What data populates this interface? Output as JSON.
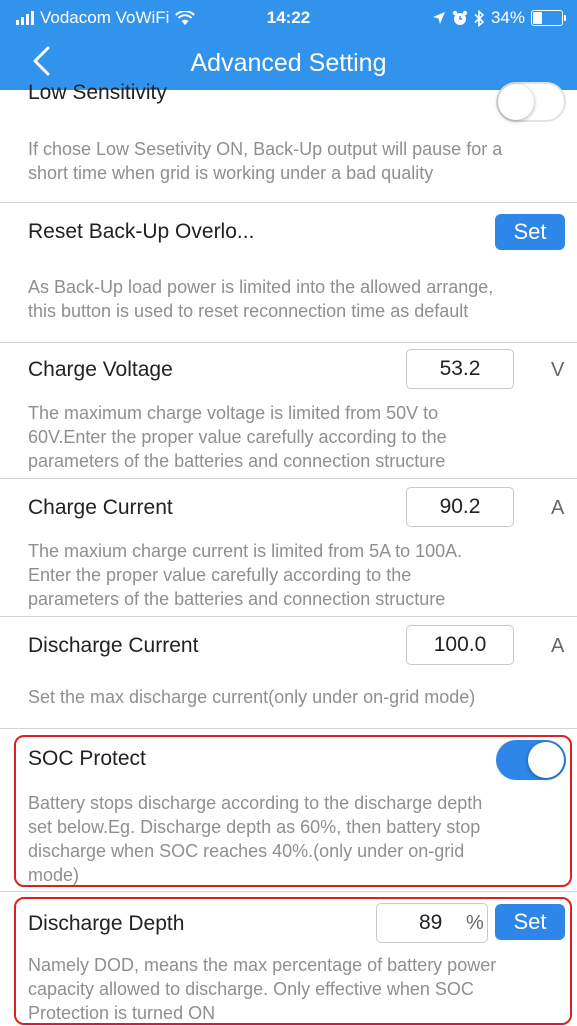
{
  "status_bar": {
    "carrier": "Vodacom VoWiFi",
    "time": "14:22",
    "battery": "34%"
  },
  "nav": {
    "title": "Advanced Setting"
  },
  "settings": {
    "low_sensitivity": {
      "title": "Low Sensitivity",
      "desc1": "If chose Low Sesetivity ON, Back-Up output will pause for a",
      "desc2": "short time when grid is working under a bad quality",
      "enabled": false
    },
    "reset_backup": {
      "title": "Reset Back-Up Overlo...",
      "button": "Set",
      "desc1": "As Back-Up load power is limited into the allowed arrange,",
      "desc2": "this button is used to reset reconnection time as default"
    },
    "charge_voltage": {
      "title": "Charge Voltage",
      "value": "53.2",
      "unit": "V",
      "desc1": "The maximum charge voltage is limited from 50V to",
      "desc2": "60V.Enter the proper value carefully according to the",
      "desc3": "parameters of the batteries and connection structure"
    },
    "charge_current": {
      "title": "Charge Current",
      "value": "90.2",
      "unit": "A",
      "desc1": "The maxium charge current is limited from 5A to 100A.",
      "desc2": "Enter the proper value carefully according to the",
      "desc3": "parameters of the batteries and connection structure"
    },
    "discharge_current": {
      "title": "Discharge Current",
      "value": "100.0",
      "unit": "A",
      "desc1": "Set the max discharge current(only under on-grid mode)"
    },
    "soc_protect": {
      "title": "SOC Protect",
      "enabled": true,
      "desc1": "Battery stops discharge according to the discharge depth",
      "desc2": "set below.Eg. Discharge depth as 60%, then battery stop",
      "desc3": "discharge when SOC reaches 40%.(only under on-grid",
      "desc4": "mode)"
    },
    "discharge_depth": {
      "title": "Discharge Depth",
      "value": "89",
      "unit": "%",
      "button": "Set",
      "desc1": "Namely DOD, means the max percentage of battery power",
      "desc2": "capacity allowed to discharge. Only effective when SOC",
      "desc3": "Protection is turned ON"
    }
  },
  "colors": {
    "header": "#3293ec",
    "accent": "#2e86e8",
    "highlight": "#e02020"
  }
}
